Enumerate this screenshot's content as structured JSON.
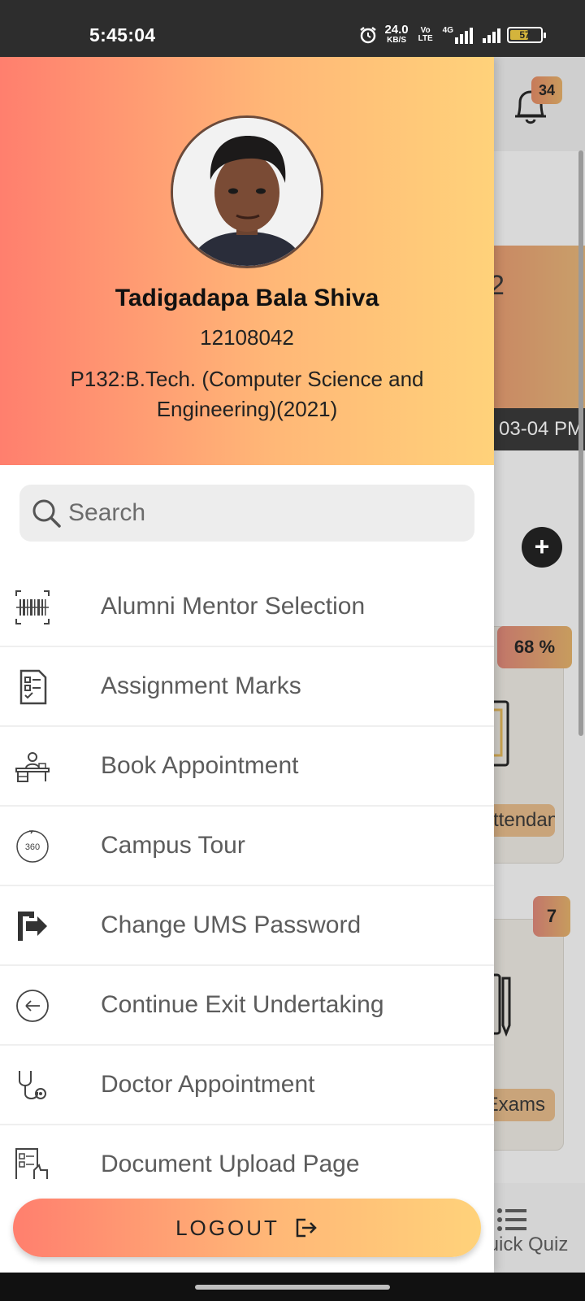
{
  "status_bar": {
    "time": "5:45:04",
    "net_speed_value": "24.0",
    "net_speed_unit": "KB/S",
    "volte_label": "Vo LTE",
    "network_label": "4G",
    "battery": "57"
  },
  "background": {
    "notification_count": "34",
    "card_number": "2",
    "time_text": "03-04 PM",
    "attendance_percent": "68 %",
    "attendance_label": "Attendance",
    "exams_count": "7",
    "exams_label": "Exams",
    "quiz_label": "Quick Quiz"
  },
  "profile": {
    "name": "Tadigadapa Bala Shiva",
    "reg_no": "12108042",
    "program": "P132:B.Tech. (Computer Science and Engineering)(2021)"
  },
  "search": {
    "placeholder": "Search"
  },
  "menu": [
    {
      "label": "Alumni Mentor Selection",
      "icon": "barcode-icon"
    },
    {
      "label": "Assignment Marks",
      "icon": "checklist-document-icon"
    },
    {
      "label": "Book Appointment",
      "icon": "office-desk-icon"
    },
    {
      "label": "Campus Tour",
      "icon": "360-view-icon"
    },
    {
      "label": "Change UMS Password",
      "icon": "exit-door-icon"
    },
    {
      "label": "Continue Exit Undertaking",
      "icon": "back-arrow-circle-icon"
    },
    {
      "label": "Doctor Appointment",
      "icon": "stethoscope-icon"
    },
    {
      "label": "Document Upload Page",
      "icon": "document-upload-icon"
    }
  ],
  "logout": {
    "label": "LOGOUT"
  },
  "colors": {
    "gradient_start": "#ff7f6e",
    "gradient_mid": "#ffb777",
    "gradient_end": "#ffd27a"
  }
}
